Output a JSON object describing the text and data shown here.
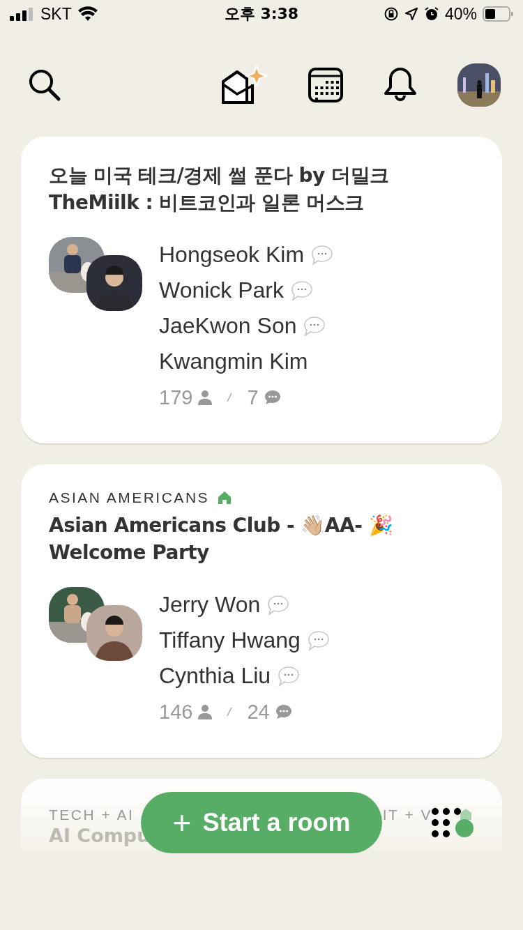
{
  "status_bar": {
    "carrier": "SKT",
    "time": "오후 3:38",
    "battery": "40%"
  },
  "rooms": [
    {
      "title": "오늘 미국 테크/경제 썰 푼다 by 더밀크 TheMiilk : 비트코인과 일론 머스크",
      "speakers": [
        {
          "name": "Hongseok Kim",
          "chat_bubble": true
        },
        {
          "name": "Wonick Park",
          "chat_bubble": true
        },
        {
          "name": "JaeKwon Son",
          "chat_bubble": true
        },
        {
          "name": "Kwangmin Kim",
          "chat_bubble": false
        }
      ],
      "listeners": "179",
      "speakers_count": "7"
    },
    {
      "club": "ASIAN AMERICANS",
      "club_home": true,
      "title": "Asian Americans Club - 👋🏼AA- 🎉 Welcome Party",
      "speakers": [
        {
          "name": "Jerry Won",
          "chat_bubble": true
        },
        {
          "name": "Tiffany Hwang",
          "chat_bubble": true
        },
        {
          "name": "Cynthia Liu",
          "chat_bubble": true
        }
      ],
      "listeners": "146",
      "speakers_count": "24"
    }
  ],
  "partial_room": {
    "club_left": "TECH + AI",
    "club_right": "IT + V",
    "title": "AI Compu"
  },
  "start_button": {
    "icon": "+",
    "label": "Start a room"
  }
}
